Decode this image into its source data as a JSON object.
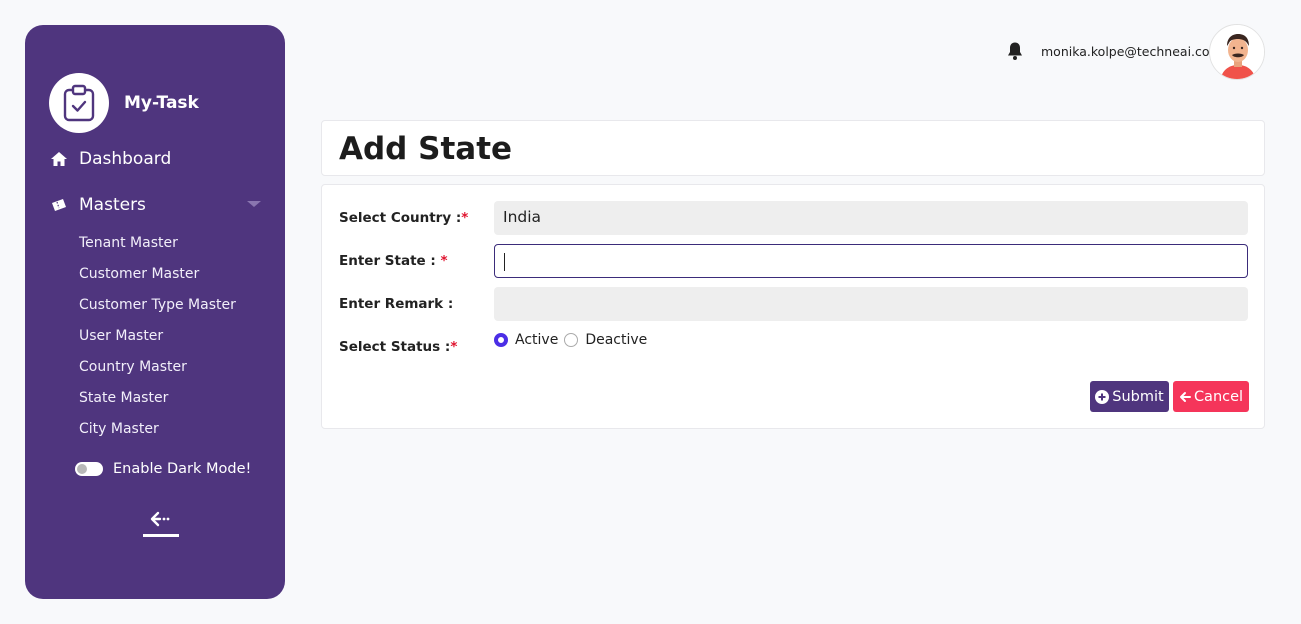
{
  "sidebar": {
    "brand": "My-Task",
    "dashboard": "Dashboard",
    "masters": "Masters",
    "submenu": [
      "Tenant Master",
      "Customer Master",
      "Customer Type Master",
      "User Master",
      "Country Master",
      "State Master",
      "City Master"
    ],
    "dark_mode": "Enable Dark Mode!"
  },
  "header": {
    "email": "monika.kolpe@techneai.com"
  },
  "page": {
    "title": "Add State"
  },
  "form": {
    "country_label": "Select Country :",
    "country_value": "India",
    "state_label": "Enter State : ",
    "state_value": "",
    "remark_label": "Enter Remark :",
    "remark_value": "",
    "status_label": "Select Status :",
    "status_options": [
      "Active",
      "Deactive"
    ],
    "status_selected": "Active",
    "required_mark": "*",
    "submit": "Submit",
    "cancel": "Cancel"
  },
  "colors": {
    "sidebar_bg": "#4f357e",
    "submit_bg": "#4f357e",
    "cancel_bg": "#f5355a",
    "required": "#e0142f",
    "radio_selected": "#4b2ee6"
  },
  "icons": [
    "clipboard-check-icon",
    "home-icon",
    "ticket-icon",
    "chevron-down-icon",
    "toggle-icon",
    "collapse-sidebar-icon",
    "bell-icon",
    "avatar",
    "plus-circle-icon",
    "arrow-left-icon"
  ]
}
